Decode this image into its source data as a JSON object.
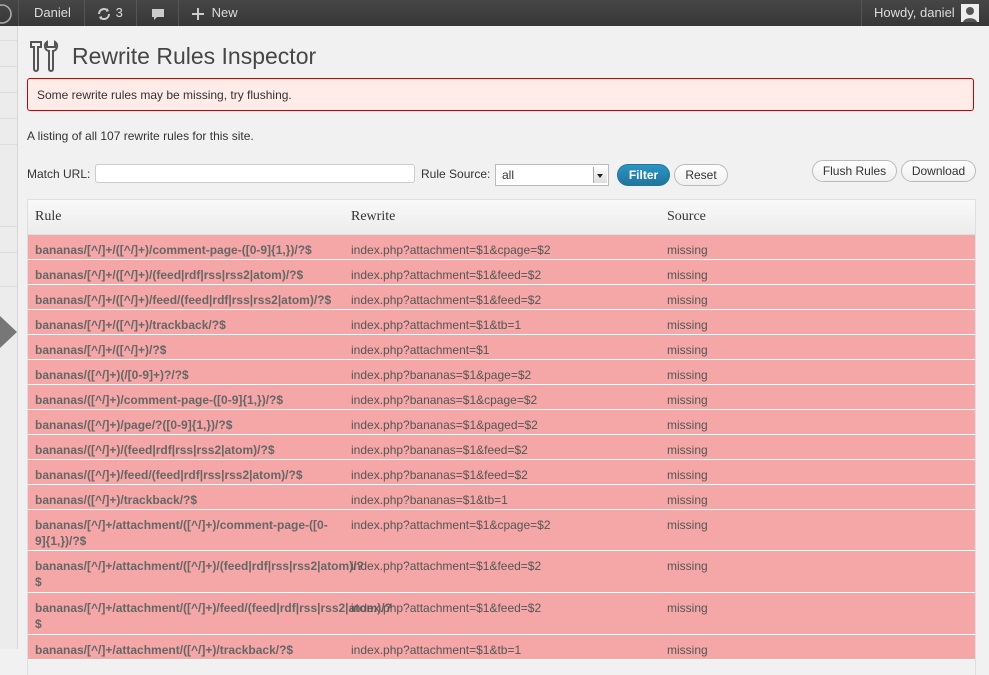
{
  "adminbar": {
    "site_name": "Daniel",
    "updates_count": "3",
    "new_label": "New",
    "howdy": "Howdy, daniel"
  },
  "page": {
    "title": "Rewrite Rules Inspector",
    "notice": "Some rewrite rules may be missing, try flushing.",
    "listing": "A listing of all 107 rewrite rules for this site."
  },
  "filter": {
    "match_url_label": "Match URL:",
    "match_url_value": "",
    "rule_source_label": "Rule Source:",
    "rule_source_value": "all",
    "filter_button": "Filter",
    "reset_button": "Reset",
    "flush_button": "Flush Rules",
    "download_button": "Download"
  },
  "table": {
    "headers": {
      "rule": "Rule",
      "rewrite": "Rewrite",
      "source": "Source"
    },
    "rows": [
      {
        "rule": "bananas/[^/]+/([^/]+)/comment-page-([0-9]{1,})/?$",
        "rewrite": "index.php?attachment=$1&cpage=$2",
        "source": "missing"
      },
      {
        "rule": "bananas/[^/]+/([^/]+)/(feed|rdf|rss|rss2|atom)/?$",
        "rewrite": "index.php?attachment=$1&feed=$2",
        "source": "missing"
      },
      {
        "rule": "bananas/[^/]+/([^/]+)/feed/(feed|rdf|rss|rss2|atom)/?$",
        "rewrite": "index.php?attachment=$1&feed=$2",
        "source": "missing"
      },
      {
        "rule": "bananas/[^/]+/([^/]+)/trackback/?$",
        "rewrite": "index.php?attachment=$1&tb=1",
        "source": "missing"
      },
      {
        "rule": "bananas/[^/]+/([^/]+)/?$",
        "rewrite": "index.php?attachment=$1",
        "source": "missing"
      },
      {
        "rule": "bananas/([^/]+)(/[0-9]+)?/?$",
        "rewrite": "index.php?bananas=$1&page=$2",
        "source": "missing"
      },
      {
        "rule": "bananas/([^/]+)/comment-page-([0-9]{1,})/?$",
        "rewrite": "index.php?bananas=$1&cpage=$2",
        "source": "missing"
      },
      {
        "rule": "bananas/([^/]+)/page/?([0-9]{1,})/?$",
        "rewrite": "index.php?bananas=$1&paged=$2",
        "source": "missing"
      },
      {
        "rule": "bananas/([^/]+)/(feed|rdf|rss|rss2|atom)/?$",
        "rewrite": "index.php?bananas=$1&feed=$2",
        "source": "missing"
      },
      {
        "rule": "bananas/([^/]+)/feed/(feed|rdf|rss|rss2|atom)/?$",
        "rewrite": "index.php?bananas=$1&feed=$2",
        "source": "missing"
      },
      {
        "rule": "bananas/([^/]+)/trackback/?$",
        "rewrite": "index.php?bananas=$1&tb=1",
        "source": "missing"
      },
      {
        "rule": "bananas/[^/]+/attachment/([^/]+)/comment-page-([0-9]{1,})/?$",
        "rewrite": "index.php?attachment=$1&cpage=$2",
        "source": "missing"
      },
      {
        "rule": "bananas/[^/]+/attachment/([^/]+)/(feed|rdf|rss|rss2|atom)/?$",
        "rewrite": "index.php?attachment=$1&feed=$2",
        "source": "missing"
      },
      {
        "rule": "bananas/[^/]+/attachment/([^/]+)/feed/(feed|rdf|rss|rss2|atom)/?$",
        "rewrite": "index.php?attachment=$1&feed=$2",
        "source": "missing"
      },
      {
        "rule": "bananas/[^/]+/attachment/([^/]+)/trackback/?$",
        "rewrite": "index.php?attachment=$1&tb=1",
        "source": "missing"
      }
    ]
  }
}
